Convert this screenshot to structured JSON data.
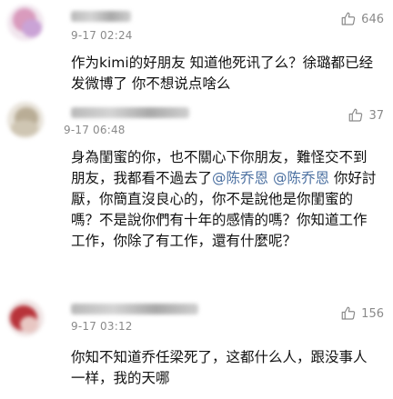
{
  "comments": [
    {
      "time": "9-17 02:24",
      "likes": "646",
      "text": "作为kimi的好朋友 知道他死讯了么？徐璐都已经发微博了 你不想说点啥么"
    },
    {
      "time": "9-17 06:48",
      "likes": "37",
      "text_parts": {
        "p1": "身為閨蜜的你，也不關心下你朋友，難怪交不到朋友，我都看不過去了",
        "m1": "@陈乔恩",
        "m2": "@陈乔恩",
        "p2": "你好討厭，你簡直沒良心的，你不是說他是你閨蜜的嗎？不是說你們有十年的感情的嗎？你知道工作工作，你除了有工作，還有什麼呢？"
      }
    },
    {
      "time": "9-17 03:12",
      "likes": "156",
      "text": "你知不知道乔任梁死了，这都什么人，跟没事人一样，我的天哪"
    }
  ],
  "icons": {
    "like": "thumbs-up-icon"
  }
}
